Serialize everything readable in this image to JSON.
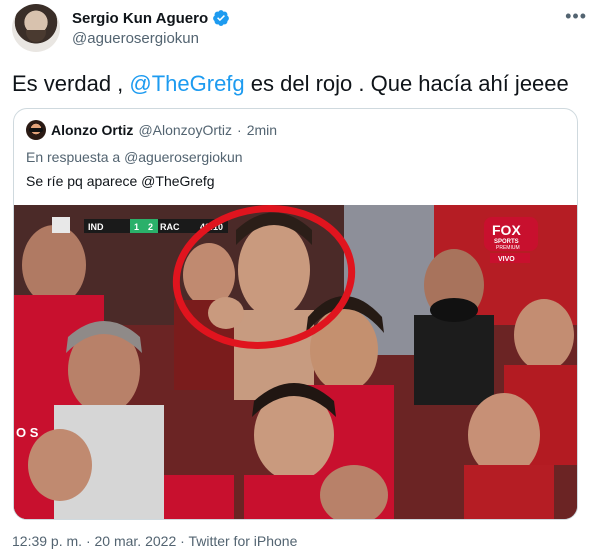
{
  "tweet": {
    "author": {
      "display_name": "Sergio Kun Aguero",
      "handle": "@aguerosergiokun",
      "verified": true
    },
    "text_before": "Es verdad , ",
    "mention": "@TheGrefg",
    "text_after": " es del rojo . Que hacía ahí jeeee",
    "more_icon": "more-icon",
    "footer": {
      "time": "12:39 p. m.",
      "date": "20 mar. 2022",
      "source": "Twitter for iPhone",
      "separator": "·"
    }
  },
  "quoted": {
    "display_name": "Alonzo Ortiz",
    "handle": "@AlonzoyOrtiz",
    "separator": "·",
    "time": "2min",
    "reply_prefix": "En respuesta a ",
    "reply_to": "@aguerosergiokun",
    "text": "Se ríe pq aparece @TheGrefg"
  },
  "broadcast": {
    "team_home": "IND",
    "score_home": "1",
    "score_away": "2",
    "team_away": "RAC",
    "clock": "40:10",
    "network_logo": "FOX",
    "network_sub": "SPORTS",
    "network_sub2": "PREMIUM",
    "live_label": "VIVO",
    "jersey_text": "O S",
    "colors": {
      "jersey_red": "#c8102e",
      "circle_red": "#e0141e",
      "link_blue": "#1d9bf0",
      "verified_blue": "#1d9bf0"
    }
  }
}
